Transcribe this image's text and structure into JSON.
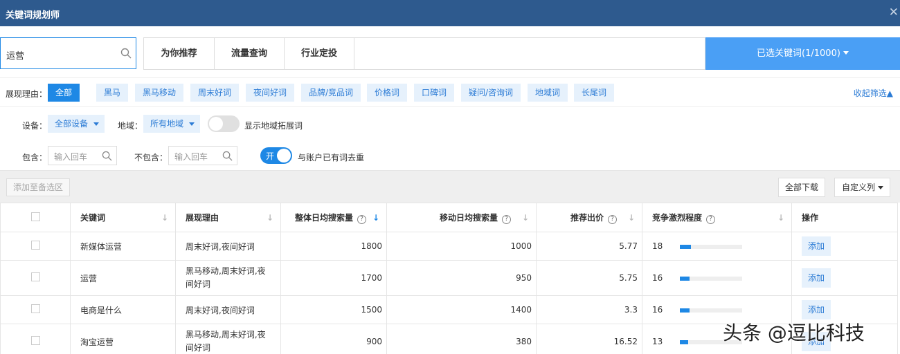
{
  "titlebar": {
    "title": "关键词规划师",
    "close": "✕"
  },
  "search": {
    "value": "运营"
  },
  "tabs": [
    {
      "label": "为你推荐"
    },
    {
      "label": "流量查询"
    },
    {
      "label": "行业定投"
    }
  ],
  "selected": {
    "label": "已选关键词(1/1000)"
  },
  "filters": {
    "reason_label": "展现理由：",
    "reasons": [
      "全部",
      "黑马",
      "黑马移动",
      "周末好词",
      "夜间好词",
      "品牌/竞品词",
      "价格词",
      "口碑词",
      "疑问/咨询词",
      "地域词",
      "长尾词"
    ],
    "collapse": "收起筛选▲",
    "device_label": "设备：",
    "device_value": "全部设备",
    "region_label": "地域：",
    "region_value": "所有地域",
    "region_expand_label": "显示地域拓展词",
    "include_label": "包含：",
    "include_placeholder": "输入回车",
    "exclude_label": "不包含：",
    "exclude_placeholder": "输入回车",
    "dedupe_switch_text": "开",
    "dedupe_label": "与账户已有词去重"
  },
  "toolbar": {
    "add_label": "添加至备选区",
    "download_label": "全部下载",
    "columns_label": "自定义列"
  },
  "table": {
    "headers": [
      "关键词",
      "展现理由",
      "整体日均搜索量",
      "移动日均搜索量",
      "推荐出价",
      "竞争激烈程度",
      "操作"
    ],
    "rows": [
      {
        "keyword": "新媒体运营",
        "reason": "周末好词,夜间好词",
        "total": "1800",
        "mobile": "1000",
        "bid": "5.77",
        "competition": "18",
        "competition_level": 0.18,
        "action": "添加"
      },
      {
        "keyword": "运营",
        "reason": "黑马移动,周末好词,夜间好词",
        "total": "1700",
        "mobile": "950",
        "bid": "5.75",
        "competition": "16",
        "competition_level": 0.16,
        "action": "添加"
      },
      {
        "keyword": "电商是什么",
        "reason": "周末好词,夜间好词",
        "total": "1500",
        "mobile": "1400",
        "bid": "3.3",
        "competition": "16",
        "competition_level": 0.16,
        "action": "添加"
      },
      {
        "keyword": "淘宝运营",
        "reason": "黑马移动,周末好词,夜间好词",
        "total": "900",
        "mobile": "380",
        "bid": "16.52",
        "competition": "13",
        "competition_level": 0.13,
        "action": "添加"
      }
    ]
  },
  "watermark": "头条 @逗比科技"
}
